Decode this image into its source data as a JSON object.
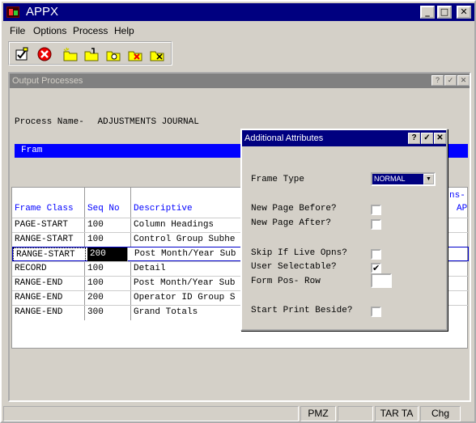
{
  "app": {
    "title": "APPX"
  },
  "menu": [
    "File",
    "Options",
    "Process",
    "Help"
  ],
  "toolbar_icons": [
    "check-edit-icon",
    "cancel-icon",
    "new-folder-icon",
    "folder-open-icon",
    "folder-search-icon",
    "folder-delete-icon",
    "folder-close-icon"
  ],
  "subwindow": {
    "title": "Output Processes"
  },
  "process": {
    "label": "Process Name-",
    "name": "ADJUSTMENTS JOURNAL"
  },
  "section_bar": "Fram",
  "table": {
    "headers": [
      "Frame Class",
      "Seq No",
      "Descriptive"
    ],
    "extra_header_1": "ns-",
    "extra_header_2": "AP",
    "rows": [
      {
        "cls": "PAGE-START",
        "seq": "100",
        "desc": "Column Headings"
      },
      {
        "cls": "RANGE-START",
        "seq": "100",
        "desc": "Control Group Subhe"
      },
      {
        "cls": "RANGE-START",
        "seq": "200",
        "desc": "Post Month/Year Sub"
      },
      {
        "cls": "RECORD",
        "seq": "100",
        "desc": "Detail"
      },
      {
        "cls": "RANGE-END",
        "seq": "100",
        "desc": "Post Month/Year Sub"
      },
      {
        "cls": "RANGE-END",
        "seq": "200",
        "desc": "Operator ID Group S"
      },
      {
        "cls": "RANGE-END",
        "seq": "300",
        "desc": "Grand Totals"
      }
    ]
  },
  "dialog": {
    "title": "Additional Attributes",
    "frame_type_label": "Frame Type",
    "frame_type_value": "NORMAL",
    "new_page_before": "New Page Before?",
    "new_page_after": "New Page After?",
    "skip_if_live": "Skip If Live Opns?",
    "user_selectable": "User Selectable?",
    "user_selectable_checked": true,
    "form_pos_row": "Form Pos- Row",
    "start_print_beside": "Start Print Beside?"
  },
  "status": {
    "p1": "PMZ",
    "p2": "TAR TA",
    "p3": "Chg"
  }
}
